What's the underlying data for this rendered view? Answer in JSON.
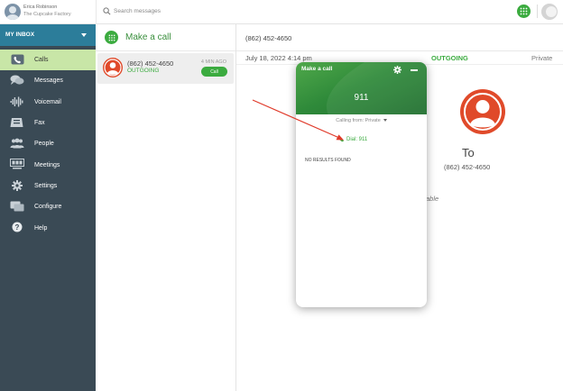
{
  "user": {
    "name": "Erica Robinson",
    "company": "The Cupcake Factory"
  },
  "search": {
    "placeholder": "Search messages"
  },
  "sidebar": {
    "inbox_label": "MY INBOX",
    "items": [
      {
        "label": "Calls",
        "icon": "phone-icon",
        "active": true
      },
      {
        "label": "Messages",
        "icon": "chat-icon",
        "active": false
      },
      {
        "label": "Voicemail",
        "icon": "voicemail-icon",
        "active": false
      },
      {
        "label": "Fax",
        "icon": "fax-icon",
        "active": false
      },
      {
        "label": "People",
        "icon": "people-icon",
        "active": false
      },
      {
        "label": "Meetings",
        "icon": "meetings-icon",
        "active": false
      },
      {
        "label": "Settings",
        "icon": "gear-icon",
        "active": false
      },
      {
        "label": "Configure",
        "icon": "configure-icon",
        "active": false
      },
      {
        "label": "Help",
        "icon": "help-icon",
        "active": false
      }
    ]
  },
  "middle": {
    "title": "Make a call",
    "call_card": {
      "number": "(862) 452-4650",
      "status": "OUTGOING",
      "time": "4 MIN AGO",
      "call_button": "Call"
    }
  },
  "detail": {
    "number": "(862) 452-4650",
    "date": "July 18, 2022 4:14 pm",
    "status": "OUTGOING",
    "privacy": "Private",
    "to_label": "To",
    "to_number": "(862) 452-4650",
    "partial_text": "able"
  },
  "popup": {
    "title": "Make a call",
    "dial_value": "911",
    "calling_from": "Calling from: Private",
    "dial_link": "Dial: 911",
    "no_results": "NO RESULTS FOUND"
  },
  "colors": {
    "brand_green": "#3bab3f",
    "sidebar_bg": "#3a4a55",
    "inbox_bar": "#2c7d9a",
    "active_item": "#c8e6a7",
    "avatar_red": "#e04a2a",
    "annotation_red": "#e03a2a"
  }
}
